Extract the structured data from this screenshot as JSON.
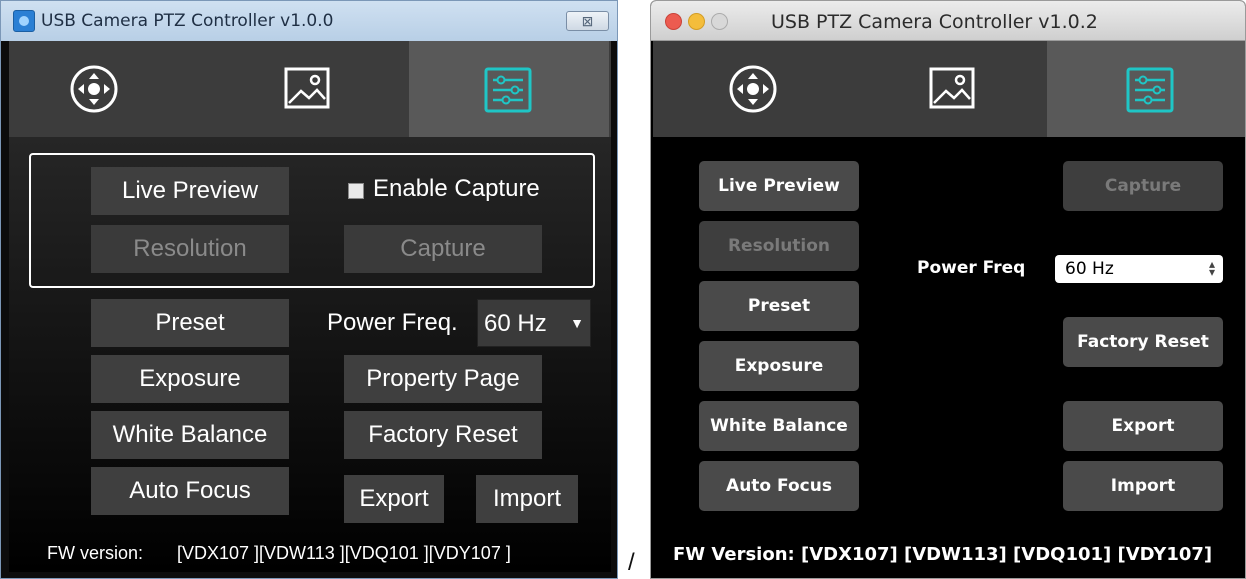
{
  "colors": {
    "panel_bg": "#000000",
    "tab_bar": "#3c3c3c",
    "tab_active": "#595959",
    "button_bg": "#3f3f3f",
    "accent_teal": "#1fc6c6",
    "disabled_text": "#8a8a8a"
  },
  "windows_app": {
    "title": "USB Camera PTZ Controller v1.0.0",
    "close_glyph": "⊠",
    "tabs": [
      {
        "icon": "ptz-control-icon",
        "active": false
      },
      {
        "icon": "image-settings-icon",
        "active": false
      },
      {
        "icon": "sliders-settings-icon",
        "active": true
      }
    ],
    "buttons": {
      "live_preview": "Live Preview",
      "resolution": "Resolution",
      "capture": "Capture",
      "preset": "Preset",
      "exposure": "Exposure",
      "white_balance": "White Balance",
      "auto_focus": "Auto Focus",
      "property_page": "Property Page",
      "factory_reset": "Factory Reset",
      "export": "Export",
      "import": "Import"
    },
    "enable_capture_label": "Enable Capture",
    "power_freq_label": "Power Freq.",
    "power_freq_value": "60 Hz",
    "fw_label": "FW version:",
    "fw_value": "[VDX107 ][VDW113 ][VDQ101 ][VDY107 ]"
  },
  "separator": "/",
  "mac_app": {
    "title": "USB PTZ Camera Controller v1.0.2",
    "tabs": [
      {
        "icon": "ptz-control-icon",
        "active": false
      },
      {
        "icon": "image-settings-icon",
        "active": false
      },
      {
        "icon": "sliders-settings-icon",
        "active": true
      }
    ],
    "buttons": {
      "live_preview": "Live Preview",
      "resolution": "Resolution",
      "preset": "Preset",
      "exposure": "Exposure",
      "white_balance": "White Balance",
      "auto_focus": "Auto Focus",
      "capture": "Capture",
      "factory_reset": "Factory Reset",
      "export": "Export",
      "import": "Import"
    },
    "power_freq_label": "Power Freq",
    "power_freq_value": "60 Hz",
    "fw_line": "FW Version: [VDX107]  [VDW113] [VDQ101] [VDY107]"
  }
}
